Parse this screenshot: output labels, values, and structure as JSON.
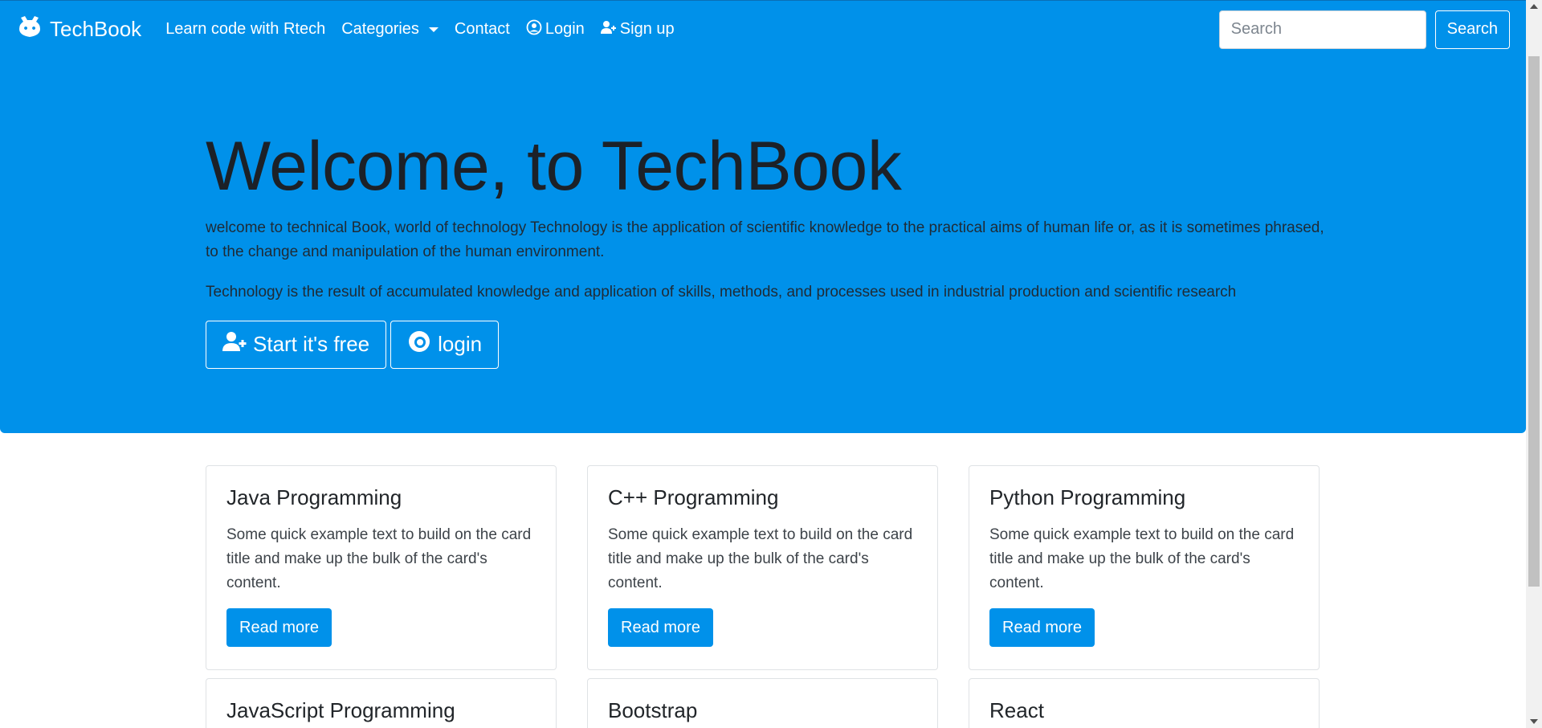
{
  "navbar": {
    "brand": "TechBook",
    "links": [
      {
        "label": "Learn code with Rtech"
      },
      {
        "label": "Categories"
      },
      {
        "label": "Contact"
      },
      {
        "label": "Login"
      },
      {
        "label": "Sign up"
      }
    ],
    "search_placeholder": "Search",
    "search_button": "Search"
  },
  "hero": {
    "title": "Welcome, to TechBook",
    "paragraph1": "welcome to technical Book, world of technology Technology is the application of scientific knowledge to the practical aims of human life or, as it is sometimes phrased, to the change and manipulation of the human environment.",
    "paragraph2": "Technology is the result of accumulated knowledge and application of skills, methods, and processes used in industrial production and scientific research",
    "start_button": "Start it's free",
    "login_button": "login"
  },
  "cards": [
    {
      "title": "Java Programming",
      "text": "Some quick example text to build on the card title and make up the bulk of the card's content.",
      "button": "Read more"
    },
    {
      "title": "C++ Programming",
      "text": "Some quick example text to build on the card title and make up the bulk of the card's content.",
      "button": "Read more"
    },
    {
      "title": "Python Programming",
      "text": "Some quick example text to build on the card title and make up the bulk of the card's content.",
      "button": "Read more"
    },
    {
      "title": "JavaScript Programming"
    },
    {
      "title": "Bootstrap"
    },
    {
      "title": "React"
    }
  ],
  "colors": {
    "primary": "#0091ea",
    "white": "#ffffff"
  },
  "icons": {
    "brand": "bug-icon",
    "login": "user-circle-icon",
    "signup": "user-plus-icon",
    "start": "user-plus-icon",
    "hero_login": "circle-user-icon"
  }
}
